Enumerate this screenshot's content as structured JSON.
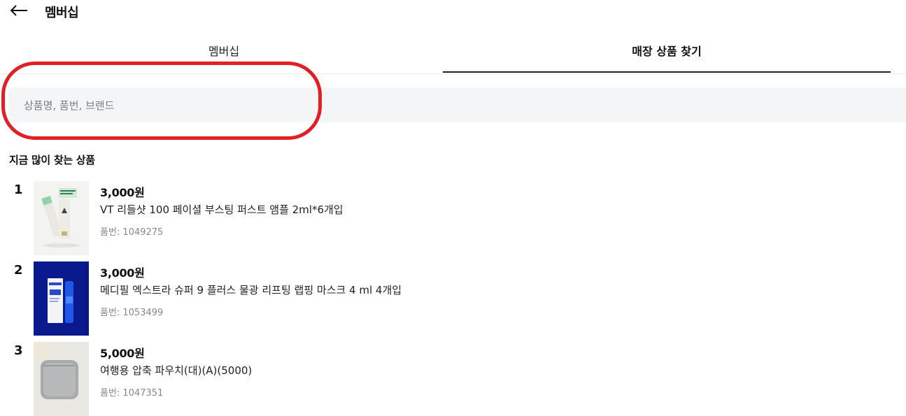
{
  "header": {
    "back_icon": "arrow-left-icon",
    "title": "멤버십"
  },
  "tabs": [
    {
      "label": "멤버십",
      "active": false
    },
    {
      "label": "매장 상품 찾기",
      "active": true
    }
  ],
  "search": {
    "placeholder": "상품명, 품번, 브랜드",
    "value": ""
  },
  "highlight_color": "#e41e25",
  "popular": {
    "title": "지금 많이 찾는 상품",
    "items": [
      {
        "rank": "1",
        "price": "3,000원",
        "name": "VT 리들샷 100 페이셜 부스팅 퍼스트 앰플 2ml*6개입",
        "code": "품번: 1049275"
      },
      {
        "rank": "2",
        "price": "3,000원",
        "name": "메디필 엑스트라 슈퍼 9 플러스 물광 리프팅 랩핑 마스크 4 ml 4개입",
        "code": "품번: 1053499"
      },
      {
        "rank": "3",
        "price": "5,000원",
        "name": "여행용 압축 파우치(대)(A)(5000)",
        "code": "품번: 1047351"
      }
    ]
  }
}
